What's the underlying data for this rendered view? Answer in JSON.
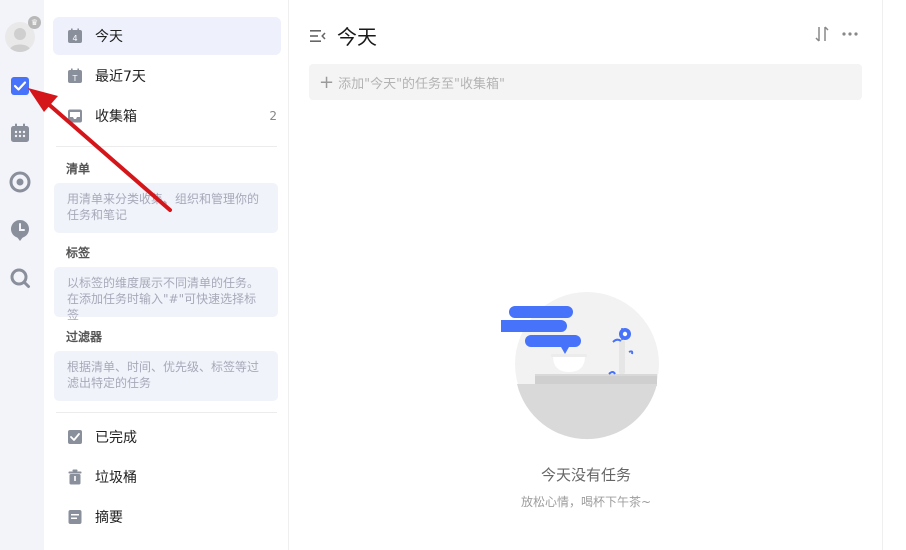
{
  "sidebar": {
    "today": "今天",
    "today_day": "4",
    "next7": "最近7天",
    "next7_letter": "T",
    "inbox": "收集箱",
    "inbox_count": "2",
    "lists_title": "清单",
    "lists_hint": "用清单来分类收集、组织和管理你的任务和笔记",
    "tags_title": "标签",
    "tags_hint": "以标签的维度展示不同清单的任务。在添加任务时输入\"#\"可快速选择标签",
    "filters_title": "过滤器",
    "filters_hint": "根据清单、时间、优先级、标签等过滤出特定的任务",
    "completed": "已完成",
    "trash": "垃圾桶",
    "summary": "摘要"
  },
  "main": {
    "title": "今天",
    "add_placeholder": "添加\"今天\"的任务至\"收集箱\"",
    "empty_title": "今天没有任务",
    "empty_subtitle": "放松心情，喝杯下午茶~"
  },
  "colors": {
    "accent": "#4772fa",
    "rail_bg": "#f3f4fa",
    "active_bg": "#eef0fc",
    "annotation_arrow": "#d4161b"
  }
}
